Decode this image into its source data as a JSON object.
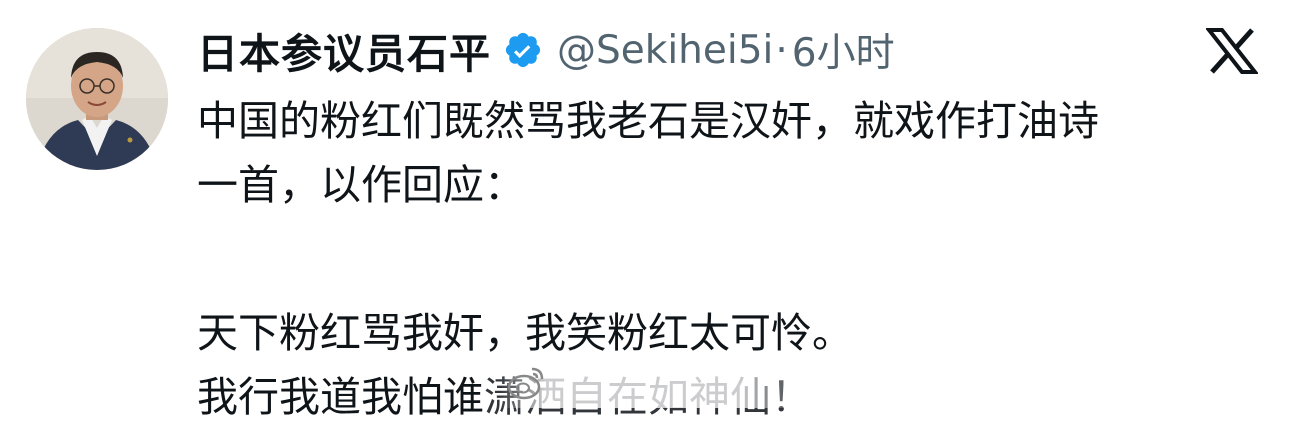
{
  "post": {
    "author": {
      "display_name": "日本参议员石平",
      "handle": "@Sekihei5i",
      "separator": "·",
      "timestamp": "6小时",
      "verified": true
    },
    "platform_icon": "x-logo-icon",
    "lines": {
      "line1": "中国的粉红们既然骂我老石是汉奸，就戏作打油诗",
      "line2": "一首，以作回应：",
      "line3": "天下粉红骂我奸，我笑粉红太可怜。",
      "line4_visible": "我行我道我怕谁",
      "line4_obscured": "潇洒自在如神仙！"
    }
  },
  "colors": {
    "verified_blue": "#1d9bf0",
    "text_primary": "#0f1419",
    "text_secondary": "#536471"
  },
  "icons": {
    "verified": "verified-badge-icon",
    "platform": "x-logo-icon",
    "watermark": "weibo-watermark-icon"
  }
}
